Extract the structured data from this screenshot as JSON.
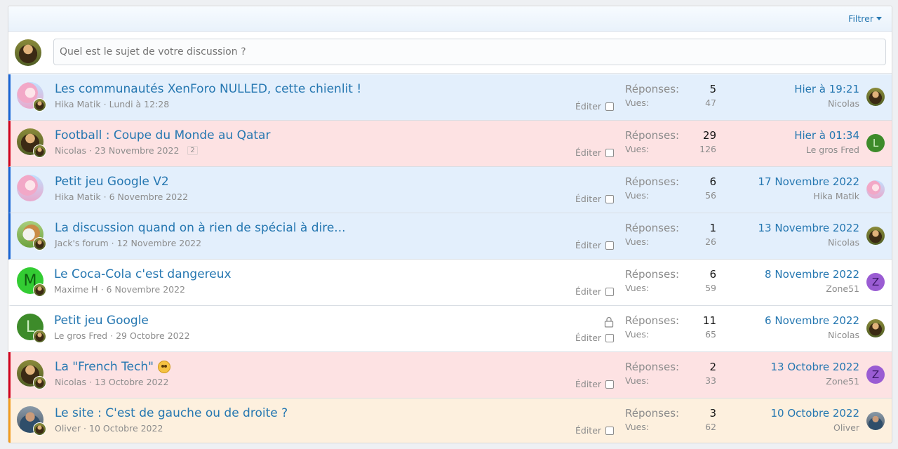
{
  "filter": {
    "label": "Filtrer"
  },
  "new_thread": {
    "placeholder": "Quel est le sujet de votre discussion ?"
  },
  "labels": {
    "replies": "Réponses:",
    "views": "Vues:",
    "edit": "Éditer"
  },
  "colors": {
    "link": "#2577b1",
    "blue_marker": "#1764d5",
    "red_marker": "#d2001b",
    "orange_marker": "#f29b1d"
  },
  "threads": [
    {
      "title": "Les communautés XenForo NULLED, cette chienlit !",
      "author": "Hika Matik",
      "date": "Lundi à 12:28",
      "replies": "5",
      "views": "47",
      "last_date": "Hier à 19:21",
      "last_user": "Nicolas"
    },
    {
      "title": "Football : Coupe du Monde au Qatar",
      "author": "Nicolas",
      "date": "23 Novembre 2022",
      "page": "2",
      "replies": "29",
      "views": "126",
      "last_date": "Hier à 01:34",
      "last_user": "Le gros Fred",
      "last_avatar_letter": "L"
    },
    {
      "title": "Petit jeu Google V2",
      "author": "Hika Matik",
      "date": "6 Novembre 2022",
      "replies": "6",
      "views": "56",
      "last_date": "17 Novembre 2022",
      "last_user": "Hika Matik"
    },
    {
      "title": "La discussion quand on à rien de spécial à dire...",
      "author": "Jack's forum",
      "date": "12 Novembre 2022",
      "replies": "1",
      "views": "26",
      "last_date": "13 Novembre 2022",
      "last_user": "Nicolas"
    },
    {
      "title": "Le Coca-Cola c'est dangereux",
      "author": "Maxime H",
      "date": "6 Novembre 2022",
      "avatar_letter": "M",
      "replies": "6",
      "views": "59",
      "last_date": "8 Novembre 2022",
      "last_user": "Zone51",
      "last_avatar_letter": "Z"
    },
    {
      "title": "Petit jeu Google",
      "author": "Le gros Fred",
      "date": "29 Octobre 2022",
      "avatar_letter": "L",
      "locked": true,
      "replies": "11",
      "views": "65",
      "last_date": "6 Novembre 2022",
      "last_user": "Nicolas"
    },
    {
      "title": "La \"French Tech\"",
      "author": "Nicolas",
      "date": "13 Octobre 2022",
      "replies": "2",
      "views": "33",
      "last_date": "13 Octobre 2022",
      "last_user": "Zone51",
      "last_avatar_letter": "Z"
    },
    {
      "title": "Le site : C'est de gauche ou de droite ?",
      "author": "Oliver",
      "date": "10 Octobre 2022",
      "replies": "3",
      "views": "62",
      "last_date": "10 Octobre 2022",
      "last_user": "Oliver"
    }
  ]
}
